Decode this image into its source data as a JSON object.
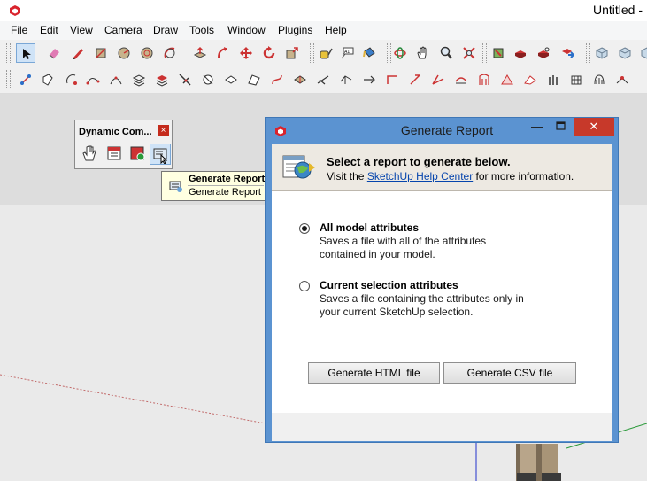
{
  "window": {
    "title": "Untitled -"
  },
  "menu": {
    "items": [
      "File",
      "Edit",
      "View",
      "Camera",
      "Draw",
      "Tools",
      "Window",
      "Plugins",
      "Help"
    ]
  },
  "toolbar_row1": {
    "icons": [
      "select-icon",
      "eraser-icon",
      "pencil-icon",
      "rectangle-icon",
      "circle-icon",
      "polygon-icon",
      "arc-icon",
      "push-pull-icon",
      "follow-me-icon",
      "move-icon",
      "rotate-icon",
      "tape-measure-icon",
      "text-icon",
      "paint-bucket-icon",
      "orbit-icon",
      "pan-icon",
      "zoom-icon",
      "zoom-extents-icon",
      "component-icon",
      "warehouse-icon",
      "share-model-icon",
      "get-models-icon",
      "view-iso-icon",
      "view-top-icon",
      "view-front-icon"
    ]
  },
  "toolbar_row2": {
    "icons": [
      "sandbox-icon",
      "tool-2-icon",
      "tool-3-icon",
      "tool-4-icon",
      "tool-5-icon",
      "tool-6-icon",
      "tool-7-icon",
      "tool-8-icon",
      "tool-9-icon",
      "tool-10-icon",
      "tool-11-icon",
      "tool-12-icon",
      "tool-13-icon",
      "tool-14-icon",
      "tool-15-icon",
      "tool-16-icon",
      "tool-17-icon",
      "tool-18-icon",
      "tool-19-icon",
      "tool-20-icon",
      "tool-21-icon",
      "tool-22-icon",
      "tool-23-icon",
      "tool-24-icon",
      "tool-25-icon",
      "tool-26-icon",
      "tool-27-icon"
    ]
  },
  "colors": {
    "dialog_frame": "#5b93d1",
    "close_red": "#c7392a",
    "link": "#0645ad",
    "tooltip_bg": "#ffffe1"
  },
  "dc_palette": {
    "title": "Dynamic Com...",
    "close_glyph": "×",
    "buttons": [
      "interact-icon",
      "component-options-icon",
      "component-attributes-icon",
      "generate-report-icon"
    ]
  },
  "tooltip": {
    "title": "Generate Report",
    "description": "Generate Report"
  },
  "dialog": {
    "title": "Generate Report",
    "minimize_glyph": "—",
    "close_glyph": "✕",
    "heading": "Select a report to generate below.",
    "visit_prefix": "Visit the ",
    "visit_link": "SketchUp Help Center",
    "visit_suffix": " for more information.",
    "options": [
      {
        "label": "All model attributes",
        "description_lines": [
          "Saves a file with all of the attributes",
          "contained in your model."
        ],
        "checked": true
      },
      {
        "label": "Current selection attributes",
        "description_lines": [
          "Saves a file containing the attributes only in",
          "your current SketchUp selection."
        ],
        "checked": false
      }
    ],
    "buttons": {
      "html": "Generate HTML file",
      "csv": "Generate CSV file"
    }
  }
}
